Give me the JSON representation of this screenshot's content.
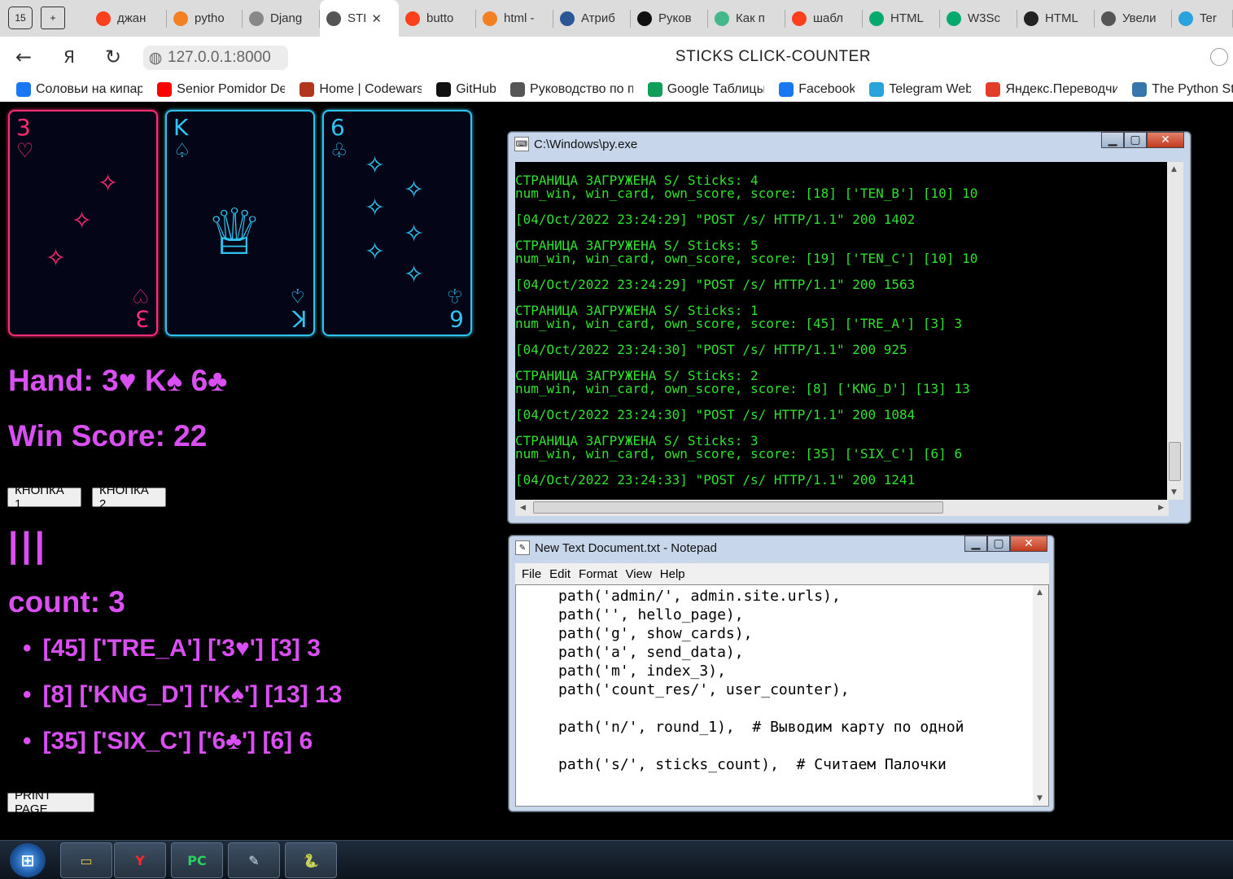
{
  "browser": {
    "tab_counter": "15",
    "tabs": [
      {
        "label": "джан",
        "icon": "yandex-icon",
        "color": "#fc3f1d"
      },
      {
        "label": "pytho",
        "icon": "stackoverflow-icon",
        "color": "#f48024"
      },
      {
        "label": "Djang",
        "icon": "mail-icon",
        "color": "#888888"
      },
      {
        "label": "STI",
        "icon": "page-icon",
        "color": "#555555",
        "active": true
      },
      {
        "label": "butto",
        "icon": "yandex-icon",
        "color": "#fc3f1d"
      },
      {
        "label": "html -",
        "icon": "stackoverflow-icon",
        "color": "#f48024"
      },
      {
        "label": "Атриб",
        "icon": "star-icon",
        "color": "#2b5797"
      },
      {
        "label": "Руков",
        "icon": "m-icon",
        "color": "#111111"
      },
      {
        "label": "Как п",
        "icon": "django-icon",
        "color": "#44b78b"
      },
      {
        "label": "шабл",
        "icon": "yandex-icon",
        "color": "#fc3f1d"
      },
      {
        "label": "HTML",
        "icon": "w3-icon",
        "color": "#04aa6d"
      },
      {
        "label": "W3Sc",
        "icon": "w3-icon",
        "color": "#04aa6d"
      },
      {
        "label": "HTML",
        "icon": "plane-icon",
        "color": "#222222"
      },
      {
        "label": "Увели",
        "icon": "people-icon",
        "color": "#555555"
      },
      {
        "label": "Ter",
        "icon": "telegram-icon",
        "color": "#2aa3dd"
      }
    ],
    "url": "127.0.0.1:8000",
    "page_title": "STICKS CLICK-COUNTER",
    "bookmarks": [
      {
        "label": "Соловьи на кипар",
        "icon": "facebook-icon",
        "color": "#1877f2"
      },
      {
        "label": "Senior Pomidor De",
        "icon": "youtube-icon",
        "color": "#ff0000"
      },
      {
        "label": "Home | Codewars",
        "icon": "codewars-icon",
        "color": "#b1361e"
      },
      {
        "label": "GitHub",
        "icon": "github-icon",
        "color": "#111111"
      },
      {
        "label": "Руководство по п",
        "icon": "m-icon",
        "color": "#555555"
      },
      {
        "label": "Google Таблицы",
        "icon": "sheets-icon",
        "color": "#0f9d58"
      },
      {
        "label": "Facebook",
        "icon": "facebook-icon",
        "color": "#1877f2"
      },
      {
        "label": "Telegram Web",
        "icon": "telegram-icon",
        "color": "#2aa3dd"
      },
      {
        "label": "Яндекс.Переводчи",
        "icon": "translate-icon",
        "color": "#e33c2b"
      },
      {
        "label": "The Python St",
        "icon": "python-icon",
        "color": "#3776ab"
      }
    ]
  },
  "game": {
    "cards": [
      {
        "rank": "3",
        "suit": "♡",
        "color": "#ff2d75"
      },
      {
        "rank": "K",
        "suit": "♤",
        "color": "#2fc4f0"
      },
      {
        "rank": "6",
        "suit": "♧",
        "color": "#2fc4f0"
      }
    ],
    "hand": "Hand: 3♥ K♠ 6♣",
    "win_score": "Win Score: 22",
    "button1": "КНОПКА 1",
    "button2": "КНОПКА 2",
    "sticks": "|||",
    "count": "count: 3",
    "results": [
      "[45] ['TRE_A'] ['3♥'] [3] 3",
      "[8] ['KNG_D'] ['K♠'] [13] 13",
      "[35] ['SIX_C'] ['6♣'] [6] 6"
    ],
    "print_button": "PRINT PAGE",
    "text_color": "#d94ff2"
  },
  "console": {
    "title": "C:\\Windows\\py.exe",
    "lines": [
      "СТРАНИЦА ЗАГРУЖЕНА S/ Sticks: 4",
      "num_win, win_card, own_score, score: [18] ['TEN_B'] [10] 10",
      "",
      "[04/Oct/2022 23:24:29] \"POST /s/ HTTP/1.1\" 200 1402",
      "",
      "СТРАНИЦА ЗАГРУЖЕНА S/ Sticks: 5",
      "num_win, win_card, own_score, score: [19] ['TEN_C'] [10] 10",
      "",
      "[04/Oct/2022 23:24:29] \"POST /s/ HTTP/1.1\" 200 1563",
      "",
      "СТРАНИЦА ЗАГРУЖЕНА S/ Sticks: 1",
      "num_win, win_card, own_score, score: [45] ['TRE_A'] [3] 3",
      "",
      "[04/Oct/2022 23:24:30] \"POST /s/ HTTP/1.1\" 200 925",
      "",
      "СТРАНИЦА ЗАГРУЖЕНА S/ Sticks: 2",
      "num_win, win_card, own_score, score: [8] ['KNG_D'] [13] 13",
      "",
      "[04/Oct/2022 23:24:30] \"POST /s/ HTTP/1.1\" 200 1084",
      "",
      "СТРАНИЦА ЗАГРУЖЕНА S/ Sticks: 3",
      "num_win, win_card, own_score, score: [35] ['SIX_C'] [6] 6",
      "",
      "[04/Oct/2022 23:24:33] \"POST /s/ HTTP/1.1\" 200 1241"
    ],
    "text_color": "#2fe02f"
  },
  "notepad": {
    "title": "New Text Document.txt - Notepad",
    "menu": [
      "File",
      "Edit",
      "Format",
      "View",
      "Help"
    ],
    "lines": [
      "path('admin/', admin.site.urls),",
      "path('', hello_page),",
      "path('g', show_cards),",
      "path('a', send_data),",
      "path('m', index_3),",
      "path('count_res/', user_counter),",
      "",
      "path('n/', round_1),  # Выводим карту по одной",
      "",
      "path('s/', sticks_count),  # Считаем Палочки"
    ]
  },
  "taskbar": {
    "items": [
      {
        "icon": "folder-icon",
        "glyph": "▭"
      },
      {
        "icon": "yandex-browser-icon",
        "glyph": "Y"
      },
      {
        "icon": "pycharm-icon",
        "glyph": "PC"
      },
      {
        "icon": "notepad-icon",
        "glyph": "✎"
      },
      {
        "icon": "python-launcher-icon",
        "glyph": "🐍"
      }
    ]
  }
}
